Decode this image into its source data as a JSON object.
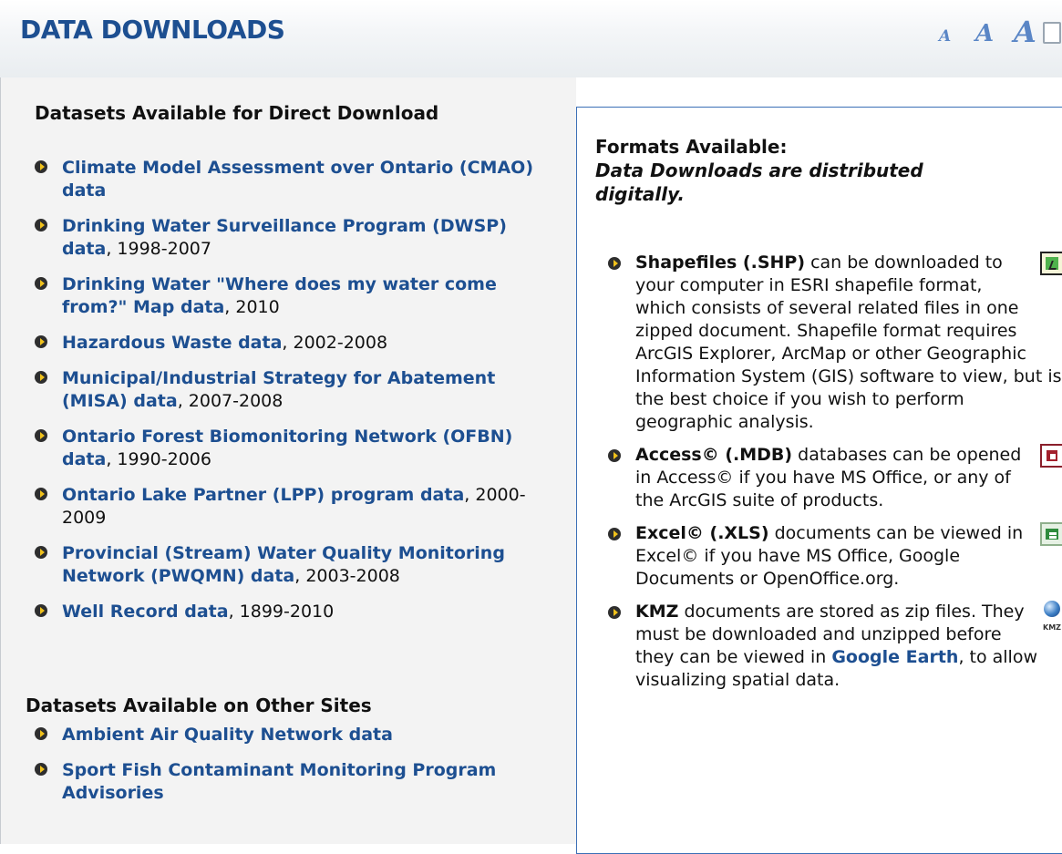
{
  "header": {
    "title": "DATA DOWNLOADS",
    "text_size": {
      "small": "A",
      "medium": "A",
      "large": "A"
    }
  },
  "left": {
    "direct_heading": "Datasets Available for Direct Download",
    "direct_items": [
      {
        "link": "Climate Model Assessment over Ontario (CMAO) data",
        "range": ""
      },
      {
        "link": "Drinking Water Surveillance Program (DWSP) data",
        "range": ", 1998-2007"
      },
      {
        "link": "Drinking Water \"Where does my water come from?\" Map data",
        "range": ", 2010"
      },
      {
        "link": "Hazardous Waste data",
        "range": ", 2002-2008"
      },
      {
        "link": "Municipal/Industrial Strategy for Abatement (MISA) data",
        "range": ", 2007-2008"
      },
      {
        "link": "Ontario Forest Biomonitoring Network (OFBN) data",
        "range": ", 1990-2006"
      },
      {
        "link": "Ontario Lake Partner (LPP) program data",
        "range": ", 2000-2009"
      },
      {
        "link": "Provincial (Stream) Water Quality Monitoring Network (PWQMN) data",
        "range": ", 2003-2008"
      },
      {
        "link": "Well Record data",
        "range": ", 1899-2010"
      }
    ],
    "other_heading": "Datasets Available on Other Sites",
    "other_items": [
      {
        "link": "Ambient Air Quality Network data"
      },
      {
        "link": "Sport Fish Contaminant Monitoring Program Advisories"
      }
    ]
  },
  "formats": {
    "title": "Formats Available:",
    "subtitle": "Data Downloads are distributed digitally.",
    "items": [
      {
        "name": "Shapefiles (.SHP)",
        "icon": "shapefile-icon",
        "text": " can be downloaded to your computer in ESRI shapefile format, which consists of several related files in one zipped document. Shapefile format requires ArcGIS Explorer, ArcMap or other Geographic Information System (GIS) software to view, but is the best choice if you wish to perform geographic analysis."
      },
      {
        "name": "Access© (.MDB)",
        "icon": "access-icon",
        "text": " databases can be opened in Access© if you have MS Office, or any of the ArcGIS suite of products."
      },
      {
        "name": "Excel© (.XLS)",
        "icon": "excel-icon",
        "text": " documents can be viewed in Excel© if you have MS Office, Google Documents or OpenOffice.org."
      },
      {
        "name": "KMZ",
        "icon": "kmz-icon",
        "icon_label": "KMZ",
        "text_before": " documents are stored as zip files. They must be downloaded and unzipped before they can be viewed in ",
        "link": "Google Earth",
        "text_after": ", to allow visualizing spatial data."
      }
    ]
  }
}
